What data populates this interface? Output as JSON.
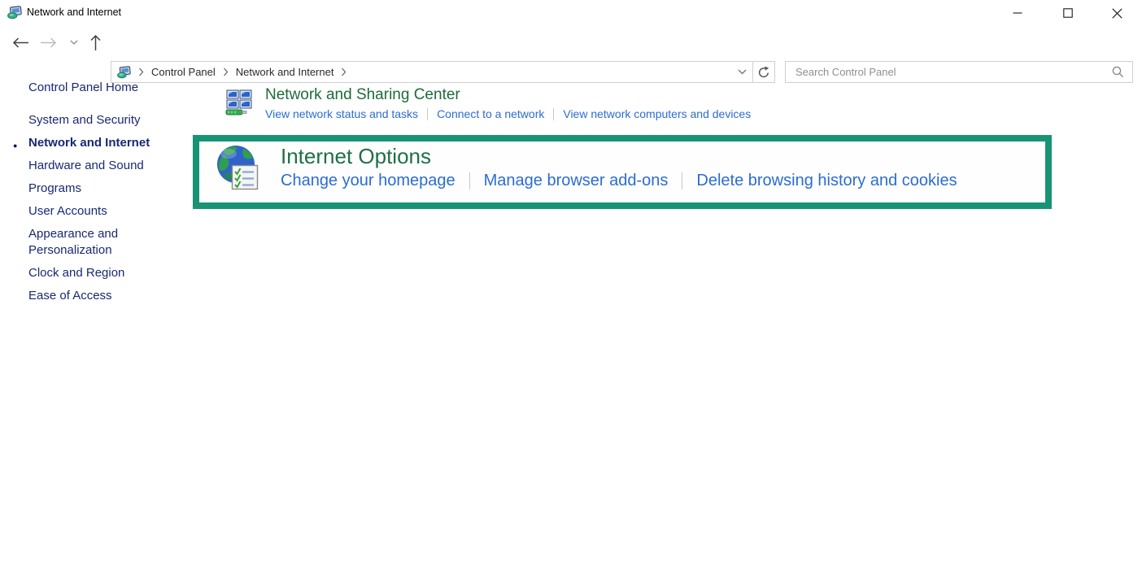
{
  "window": {
    "title": "Network and Internet",
    "controls": {
      "minimize": "minimize",
      "maximize": "maximize",
      "close": "close"
    }
  },
  "toolbar": {
    "breadcrumb": {
      "items": [
        "Control Panel",
        "Network and Internet"
      ]
    },
    "search": {
      "placeholder": "Search Control Panel"
    }
  },
  "sidebar": {
    "home": "Control Panel Home",
    "items": [
      {
        "label": "System and Security",
        "active": false
      },
      {
        "label": "Network and Internet",
        "active": true
      },
      {
        "label": "Hardware and Sound",
        "active": false
      },
      {
        "label": "Programs",
        "active": false
      },
      {
        "label": "User Accounts",
        "active": false
      },
      {
        "label": "Appearance and Personalization",
        "active": false
      },
      {
        "label": "Clock and Region",
        "active": false
      },
      {
        "label": "Ease of Access",
        "active": false
      }
    ]
  },
  "main": {
    "sections": [
      {
        "title": "Network and Sharing Center",
        "icon": "network-sharing-center-icon",
        "highlighted": false,
        "links": [
          "View network status and tasks",
          "Connect to a network",
          "View network computers and devices"
        ]
      },
      {
        "title": "Internet Options",
        "icon": "internet-options-globe-icon",
        "highlighted": true,
        "links": [
          "Change your homepage",
          "Manage browser add-ons",
          "Delete browsing history and cookies"
        ]
      }
    ]
  },
  "icons": {
    "titlebar": "control-panel-icon",
    "navigation": [
      "back-icon",
      "forward-icon",
      "recent-locations-chevron-icon",
      "up-icon"
    ],
    "address_bar": [
      "control-panel-icon",
      "breadcrumb-chevron-icon",
      "dropdown-chevron-icon",
      "refresh-icon"
    ],
    "search": "search-icon",
    "window_controls": [
      "minimize-icon",
      "maximize-icon",
      "close-icon"
    ]
  },
  "colors": {
    "category_heading_green": "#1d6b3a",
    "task_link_blue": "#2b6cd4",
    "sidebar_text_navy": "#182973",
    "highlight_border_green": "#189474"
  }
}
